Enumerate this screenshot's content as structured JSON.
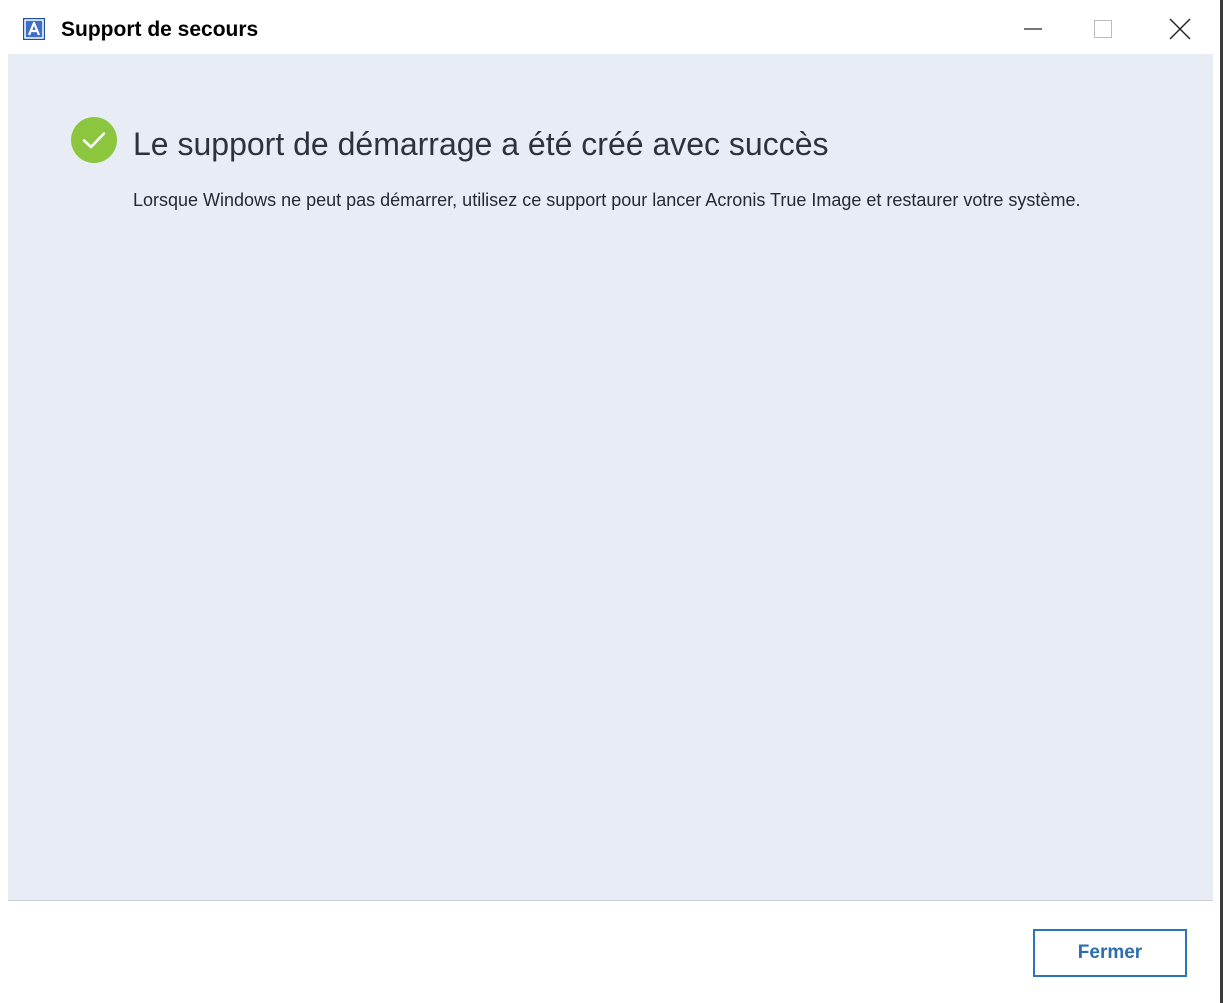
{
  "window": {
    "title": "Support de secours",
    "app_icon": "acronis-a-icon",
    "controls": {
      "minimize_icon": "minimize-icon",
      "maximize_icon": "maximize-icon",
      "close_icon": "close-icon"
    }
  },
  "main": {
    "status_icon": "success-check-icon",
    "heading": "Le support de démarrage a été créé avec succès",
    "description": "Lorsque Windows ne peut pas démarrer, utilisez ce support pour lancer Acronis True Image et restaurer votre système."
  },
  "footer": {
    "close_label": "Fermer"
  },
  "colors": {
    "content_background": "#e7ecf5",
    "success_green": "#8cc63f",
    "button_blue": "#2f74b8",
    "app_icon_blue": "#1f4fa3"
  }
}
